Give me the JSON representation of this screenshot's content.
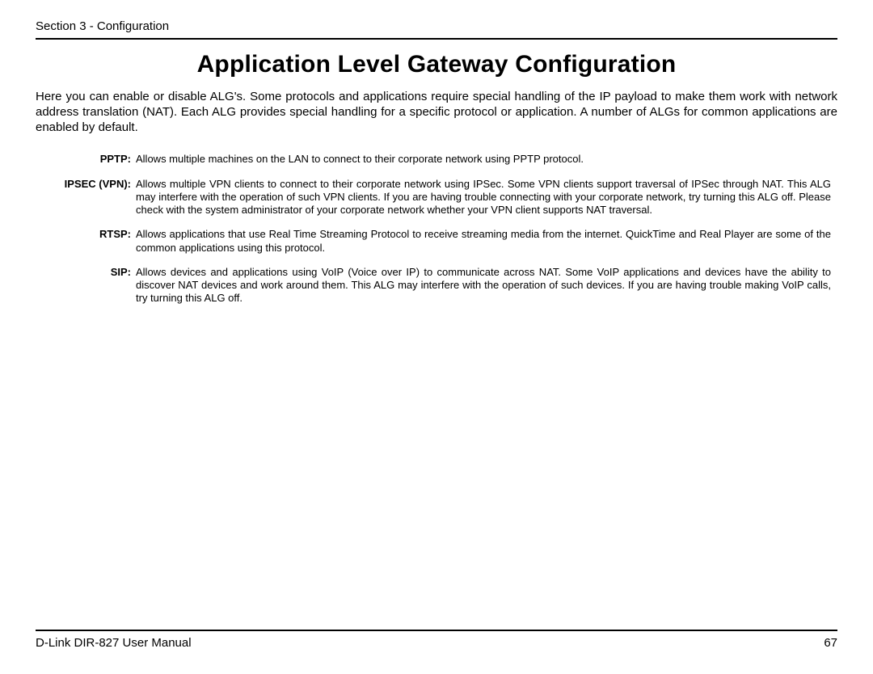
{
  "header": {
    "section_label": "Section 3 - Configuration"
  },
  "title": "Application Level Gateway Configuration",
  "intro": "Here you can enable or disable ALG's. Some protocols and applications require special handling of the IP payload to make them work with network address translation (NAT). Each ALG provides special handling for a specific protocol or application. A number of ALGs for common applications are enabled by default.",
  "definitions": [
    {
      "label": "PPTP:",
      "body": "Allows multiple machines on the LAN to connect to their corporate network using PPTP protocol."
    },
    {
      "label": "IPSEC (VPN):",
      "body": "Allows multiple VPN clients to connect to their corporate network using IPSec. Some VPN clients support traversal of IPSec through NAT. This ALG may interfere with the operation of such VPN clients. If you are having trouble connecting with your corporate network, try turning this ALG off. Please check with the system administrator of your corporate network whether your VPN client supports NAT traversal."
    },
    {
      "label": "RTSP:",
      "body": "Allows applications that use Real Time Streaming Protocol to receive streaming media from the internet. QuickTime and Real Player are some of the common applications using this protocol."
    },
    {
      "label": "SIP:",
      "body": "Allows devices and applications using VoIP (Voice over IP) to communicate across NAT. Some VoIP applications and devices have the ability to discover NAT devices and work around them. This ALG may interfere with the operation of such devices. If you are having trouble making VoIP calls, try turning this ALG off."
    }
  ],
  "footer": {
    "manual_label": "D-Link DIR-827 User Manual",
    "page_number": "67"
  }
}
